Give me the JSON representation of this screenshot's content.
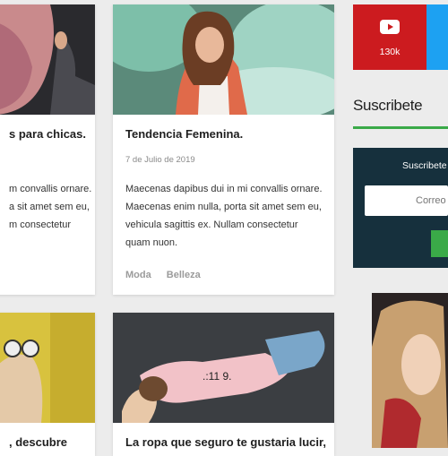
{
  "posts": [
    {
      "title": "s para chicas.",
      "excerpt": [
        "m convallis ornare.",
        "a sit amet sem eu,",
        "m consectetur"
      ]
    },
    {
      "title": "Tendencia Femenina.",
      "date": "7 de Julio de 2019",
      "excerpt": [
        "Maecenas dapibus dui in mi convallis ornare.",
        "Maecenas enim nulla, porta sit amet sem eu,",
        "vehicula sagittis ex. Nullam consectetur",
        "quam nuon."
      ],
      "tags": [
        "Moda",
        "Belleza"
      ]
    },
    {
      "title": ", descubre"
    },
    {
      "title": "La ropa que seguro te gustaria lucir,"
    }
  ],
  "sidebar": {
    "youtube": {
      "icon": "youtube-icon",
      "count": "130k",
      "color": "#cc1b1f"
    },
    "twitter_color": "#1da1f2",
    "subscribe_heading": "Suscribete",
    "subscribe_box": {
      "label": "Suscribete",
      "input_placeholder": "Correo",
      "button_color": "#3aaa48"
    }
  }
}
